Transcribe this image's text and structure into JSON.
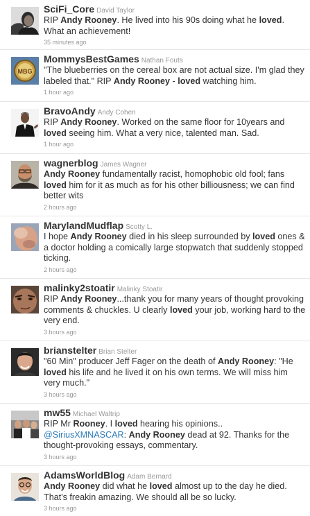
{
  "tweets": [
    {
      "screen_name": "SciFi_Core",
      "full_name": "David Taylor",
      "segments": [
        {
          "t": "RIP "
        },
        {
          "t": "Andy Rooney",
          "b": true
        },
        {
          "t": ". He lived into his 90s doing what he "
        },
        {
          "t": "loved",
          "b": true
        },
        {
          "t": ". What an achievement!"
        }
      ],
      "time": "35 minutes ago",
      "avatar": "man-portrait-dark"
    },
    {
      "screen_name": "MommysBestGames",
      "full_name": "Nathan Fouts",
      "segments": [
        {
          "t": "\"The blueberries on the cereal box are not actual size. I'm glad they labeled that.\" RIP "
        },
        {
          "t": "Andy Rooney",
          "b": true
        },
        {
          "t": " - "
        },
        {
          "t": "loved",
          "b": true
        },
        {
          "t": " watching him."
        }
      ],
      "time": "1 hour ago",
      "avatar": "mbg-logo-badge",
      "avatar_text": "MBG"
    },
    {
      "screen_name": "BravoAndy",
      "full_name": "Andy Cohen",
      "segments": [
        {
          "t": "RIP "
        },
        {
          "t": "Andy Rooney",
          "b": true
        },
        {
          "t": ". Worked on the same floor for 10years and "
        },
        {
          "t": "loved",
          "b": true
        },
        {
          "t": " seeing him. What a very nice, talented man. Sad."
        }
      ],
      "time": "1 hour ago",
      "avatar": "man-in-suit"
    },
    {
      "screen_name": "wagnerblog",
      "full_name": "James Wagner",
      "segments": [
        {
          "t": "Andy Rooney",
          "b": true
        },
        {
          "t": " fundamentally racist, homophobic old fool; fans "
        },
        {
          "t": "loved",
          "b": true
        },
        {
          "t": " him for it as much as for his other billiousness; we can find better wits"
        }
      ],
      "time": "2 hours ago",
      "avatar": "bearded-man-glasses"
    },
    {
      "screen_name": "MarylandMudflap",
      "full_name": "Scotty L.",
      "segments": [
        {
          "t": "I hope "
        },
        {
          "t": "Andy Rooney",
          "b": true
        },
        {
          "t": " died in his sleep surrounded by "
        },
        {
          "t": "loved",
          "b": true
        },
        {
          "t": " ones & a doctor holding a comically large stopwatch that suddenly stopped ticking."
        }
      ],
      "time": "2 hours ago",
      "avatar": "blurry-face"
    },
    {
      "screen_name": "malinky2stoatir",
      "full_name": "Malinky Stoatir",
      "segments": [
        {
          "t": "RIP "
        },
        {
          "t": "Andy Rooney",
          "b": true
        },
        {
          "t": "...thank you for many years of thought provoking comments & chuckles. U clearly "
        },
        {
          "t": "loved",
          "b": true
        },
        {
          "t": " your job, working hard to the very end."
        }
      ],
      "time": "3 hours ago",
      "avatar": "closeup-face"
    },
    {
      "screen_name": "brianstelter",
      "full_name": "Brian Stelter",
      "segments": [
        {
          "t": "\"60 Min\" producer Jeff Fager on the death of "
        },
        {
          "t": "Andy Rooney",
          "b": true
        },
        {
          "t": ": \"He "
        },
        {
          "t": "loved",
          "b": true
        },
        {
          "t": " his life and he lived it on his own terms. We will miss him very much.\""
        }
      ],
      "time": "3 hours ago",
      "avatar": "young-man-portrait"
    },
    {
      "screen_name": "mw55",
      "full_name": "Michael Waltrip",
      "segments": [
        {
          "t": "RIP Mr "
        },
        {
          "t": "Rooney",
          "b": true
        },
        {
          "t": ". I "
        },
        {
          "t": "loved",
          "b": true
        },
        {
          "t": " hearing his opinions.. "
        },
        {
          "t": "@SiriusXMNASCAR",
          "m": true
        },
        {
          "t": ": "
        },
        {
          "t": "Andy Rooney",
          "b": true
        },
        {
          "t": " dead at 92. Thanks for the thought-provoking essays, commentary."
        }
      ],
      "time": "3 hours ago",
      "avatar": "group-photo"
    },
    {
      "screen_name": "AdamsWorldBlog",
      "full_name": "Adam Bernard",
      "segments": [
        {
          "t": "Andy Rooney",
          "b": true
        },
        {
          "t": " did what he "
        },
        {
          "t": "loved",
          "b": true
        },
        {
          "t": " almost up to the day he died. That's freakin amazing. We should all be so lucky."
        }
      ],
      "time": "3 hours ago",
      "avatar": "man-with-glasses-smiling"
    }
  ]
}
